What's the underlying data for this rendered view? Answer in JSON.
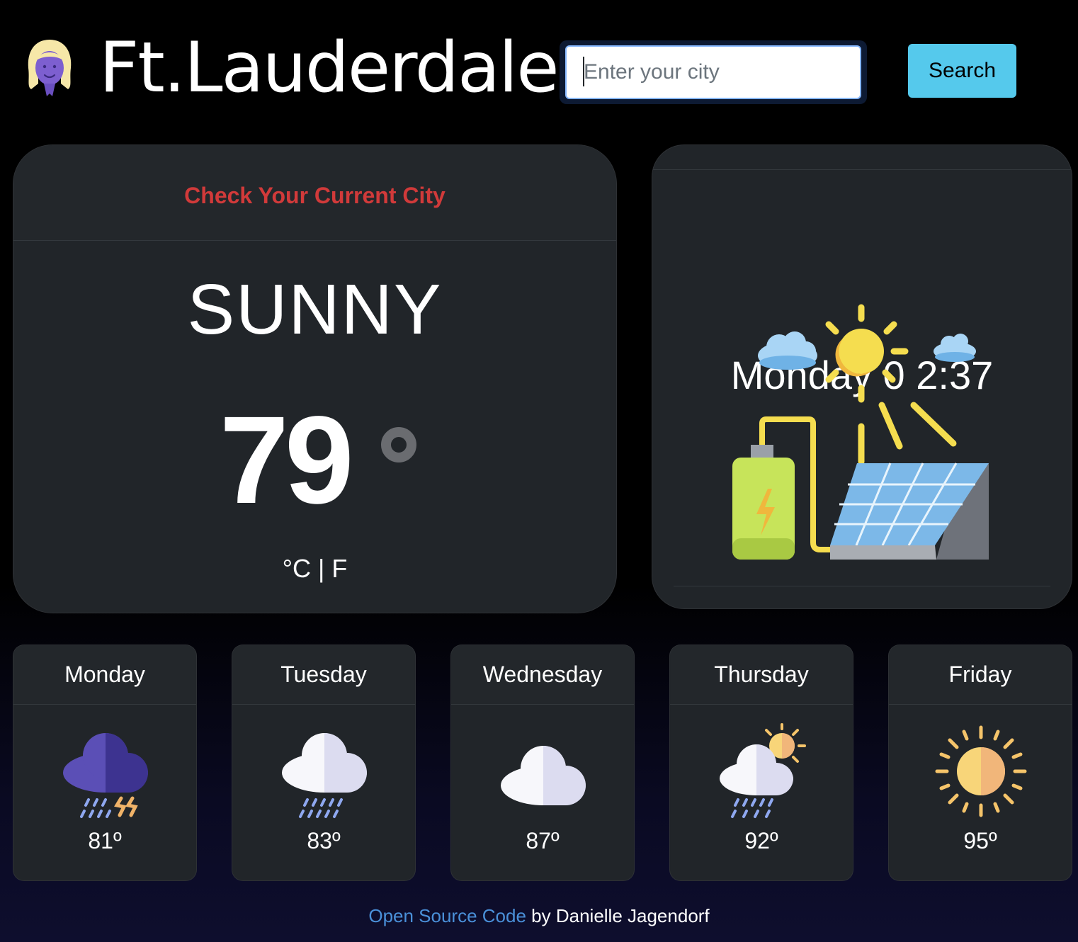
{
  "header": {
    "city": "Ft.Lauderdale",
    "avatar_icon": "woman-avatar-icon",
    "search": {
      "placeholder": "Enter your city",
      "button_label": "Search"
    }
  },
  "current": {
    "header_text": "Check Your Current City",
    "condition": "SUNNY",
    "temperature": "79",
    "unit_celsius": "°C",
    "unit_separator": " | ",
    "unit_fahrenheit": "F"
  },
  "clock": {
    "text": "Monday 0 2:37",
    "illustration_icon": "solar-panel-charging-icon"
  },
  "forecast": [
    {
      "day": "Monday",
      "temp": "81º",
      "icon": "thunderstorm-icon"
    },
    {
      "day": "Tuesday",
      "temp": "83º",
      "icon": "rain-cloud-icon"
    },
    {
      "day": "Wednesday",
      "temp": "87º",
      "icon": "cloud-icon"
    },
    {
      "day": "Thursday",
      "temp": "92º",
      "icon": "sun-rain-cloud-icon"
    },
    {
      "day": "Friday",
      "temp": "95º",
      "icon": "sun-icon"
    }
  ],
  "footer": {
    "link_text": "Open Source Code",
    "suffix": " by Danielle Jagendorf"
  },
  "colors": {
    "accent_search_button": "#55c9ec",
    "check_city_red": "#d13a3a",
    "card_background": "#212529",
    "footer_link": "#4a90d9"
  }
}
